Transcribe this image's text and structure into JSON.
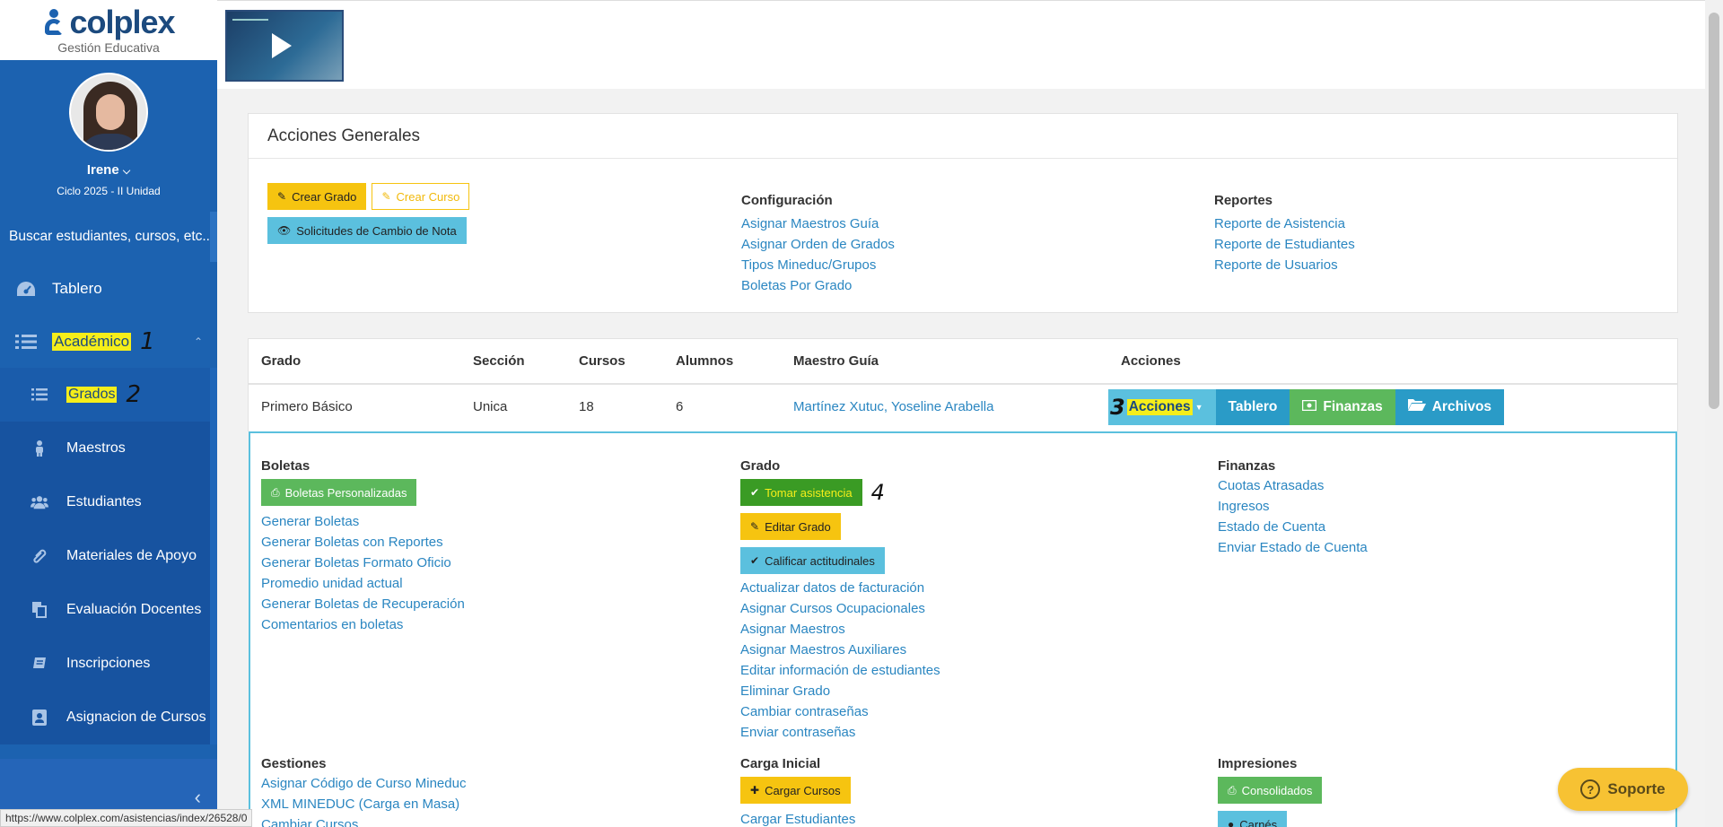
{
  "brand": {
    "name": "colplex",
    "subtitle": "Gestión Educativa"
  },
  "user": {
    "name": "Irene",
    "caret": "⌵",
    "cycle": "Ciclo 2025 - II Unidad"
  },
  "sidebar": {
    "search_text": "Buscar estudiantes, cursos, etc...",
    "items": [
      {
        "label": "Tablero",
        "icon": "dashboard-icon"
      },
      {
        "label": "Académico",
        "icon": "list-icon",
        "annotation": "1"
      }
    ],
    "sub_items": [
      {
        "label": "Grados",
        "icon": "list-icon",
        "annotation": "2"
      },
      {
        "label": "Maestros",
        "icon": "person-icon"
      },
      {
        "label": "Estudiantes",
        "icon": "group-icon"
      },
      {
        "label": "Materiales de Apoyo",
        "icon": "paperclip-icon"
      },
      {
        "label": "Evaluación Docentes",
        "icon": "copy-icon"
      },
      {
        "label": "Inscripciones",
        "icon": "book-icon"
      },
      {
        "label": "Asignacion de Cursos",
        "icon": "id-card-icon"
      }
    ]
  },
  "status_url": "https://www.colplex.com/asistencias/index/26528/0",
  "general": {
    "title": "Acciones Generales",
    "btn_create_grade": "Crear Grado",
    "btn_create_course": "Crear Curso",
    "btn_change_requests": "Solicitudes de Cambio de Nota",
    "config_title": "Configuración",
    "config_links": [
      "Asignar Maestros Guía",
      "Asignar Orden de Grados",
      "Tipos Mineduc/Grupos",
      "Boletas Por Grado"
    ],
    "reports_title": "Reportes",
    "report_links": [
      "Reporte de Asistencia",
      "Reporte de Estudiantes",
      "Reporte de Usuarios"
    ]
  },
  "table": {
    "headers": [
      "Grado",
      "Sección",
      "Cursos",
      "Alumnos",
      "Maestro Guía",
      "Acciones"
    ],
    "row": {
      "grado": "Primero Básico",
      "seccion": "Unica",
      "cursos": "18",
      "alumnos": "6",
      "maestro": "Martínez Xutuc, Yoseline Arabella"
    },
    "actions": {
      "acciones": "Acciones",
      "annotation": "3",
      "tablero": "Tablero",
      "finanzas": "Finanzas",
      "archivos": "Archivos"
    }
  },
  "dropdown": {
    "boletas": {
      "title": "Boletas",
      "button": "Boletas Personalizadas",
      "links": [
        "Generar Boletas",
        "Generar Boletas con Reportes",
        "Generar Boletas Formato Oficio",
        "Promedio unidad actual",
        "Generar Boletas de Recuperación",
        "Comentarios en boletas"
      ]
    },
    "grado": {
      "title": "Grado",
      "btn_attendance": "Tomar asistencia",
      "annotation": "4",
      "btn_edit": "Editar Grado",
      "btn_grade": "Calificar actitudinales",
      "links": [
        "Actualizar datos de facturación",
        "Asignar Cursos Ocupacionales",
        "Asignar Maestros",
        "Asignar Maestros Auxiliares",
        "Editar información de estudiantes",
        "Eliminar Grado",
        "Cambiar contraseñas",
        "Enviar contraseñas"
      ]
    },
    "finanzas": {
      "title": "Finanzas",
      "links": [
        "Cuotas Atrasadas",
        "Ingresos",
        "Estado de Cuenta",
        "Enviar Estado de Cuenta"
      ]
    },
    "gestiones": {
      "title": "Gestiones",
      "links": [
        "Asignar Código de Curso Mineduc",
        "XML MINEDUC (Carga en Masa)",
        "Cambiar Cursos"
      ]
    },
    "carga": {
      "title": "Carga Inicial",
      "button": "Cargar Cursos",
      "links": [
        "Cargar Estudiantes"
      ]
    },
    "impresiones": {
      "title": "Impresiones",
      "button": "Consolidados",
      "button2": "Carnés"
    }
  },
  "support": {
    "label": "Soporte"
  },
  "colors": {
    "sidebar": "#1c62b0",
    "link": "#2a86c1",
    "yellow": "#f6c410",
    "cyan": "#5bc0de",
    "green": "#5cb85c"
  }
}
